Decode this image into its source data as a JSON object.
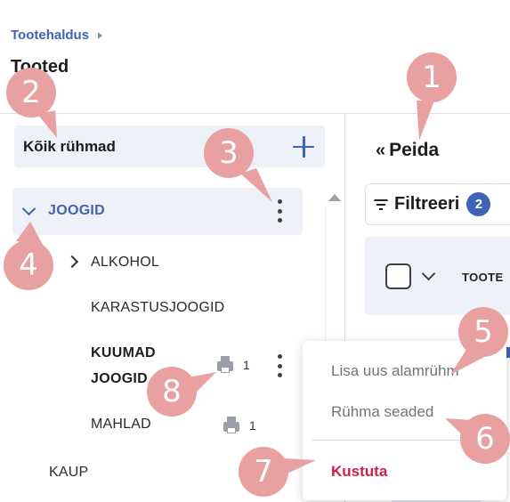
{
  "breadcrumb": {
    "parent": "Tootehaldus"
  },
  "page": {
    "title": "Tooted"
  },
  "sidebar": {
    "all_groups_label": "Kõik rühmad",
    "tree": {
      "joogid": "JOOGID",
      "alkohol": "ALKOHOL",
      "karastusjoogid": "KARASTUSJOOGID",
      "kuumad_joogid_line1": "KUUMAD",
      "kuumad_joogid_line2": "JOOGID",
      "kuumad_joogid_count": "1",
      "mahlad": "MAHLAD",
      "mahlad_count": "1",
      "kaup": "KAUP"
    }
  },
  "main": {
    "hide_arrow": "«",
    "hide_label": "Peida",
    "filter_label": "Filtreeri",
    "filter_count": "2",
    "column_header": "TOOTE"
  },
  "context_menu": {
    "add_subgroup": "Lisa uus alamrühm",
    "group_settings": "Rühma seaded",
    "delete": "Kustuta"
  },
  "callouts": [
    "1",
    "2",
    "3",
    "4",
    "5",
    "6",
    "7",
    "8"
  ],
  "colors": {
    "accent": "#3f63b7",
    "danger": "#d41c4a",
    "callout": "#e8a0a0",
    "selected_row_bg": "#eef1f7"
  }
}
